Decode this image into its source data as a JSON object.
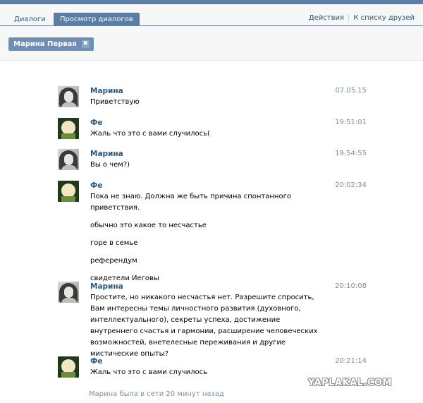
{
  "tabs": {
    "dialogs": "Диалоги",
    "view": "Просмотр диалогов",
    "actions": "Действия",
    "friends": "К списку друзей",
    "separator": "|"
  },
  "chip": {
    "label": "Марина Первая",
    "close": "✖"
  },
  "messages": [
    {
      "author": "Марина",
      "avatar": "marina-avatar-icon",
      "time": "07.05.15",
      "lines": [
        "Приветствую"
      ]
    },
    {
      "author": "Фе",
      "avatar": "fe-avatar-icon",
      "time": "19:51:01",
      "lines": [
        "Жаль что это с вами случилось("
      ]
    },
    {
      "author": "Марина",
      "avatar": "marina-avatar-icon",
      "time": "19:54:55",
      "lines": [
        "Вы о чем?)"
      ]
    },
    {
      "author": "Фе",
      "avatar": "fe-avatar-icon",
      "time": "20:02:34",
      "lines": [
        "Пока не знаю. Должна же быть причина спонтанного приветствия.",
        "обычно это какое то несчастье",
        "горе в семье",
        "референдум",
        "свидетели Иеговы"
      ]
    },
    {
      "author": "Марина",
      "avatar": "marina-avatar-icon",
      "time": "20:10:08",
      "lines": [
        "Простите, но никакого несчастья нет. Разрешите спросить, Вам интересны темы личностного развития (духовного, интеллектуального), секреты успеха, достижение внутреннего счастья и гармонии, расширение человеческих возможностей, внетелесные переживания и другие мистические опыты?"
      ]
    },
    {
      "author": "Фе",
      "avatar": "fe-avatar-icon",
      "time": "20:21:14",
      "lines": [
        "Жаль что это с вами случилось"
      ]
    }
  ],
  "status": "Марина была в сети 20 минут назад",
  "watermark": "YAPLAKAL.COM",
  "colors": {
    "accent": "#597da3",
    "link": "#2b587a",
    "muted": "#7f8c97"
  }
}
